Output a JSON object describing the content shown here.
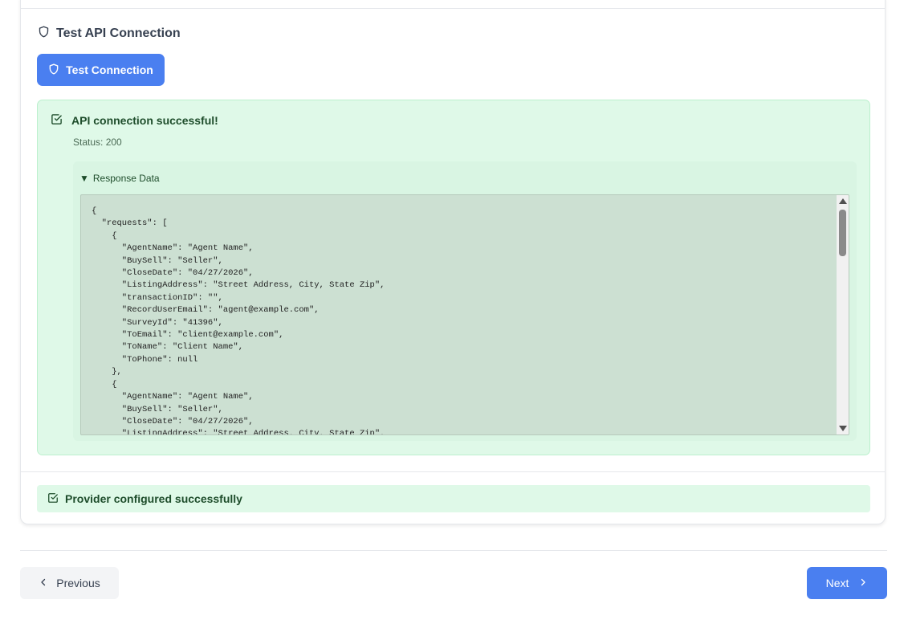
{
  "test_section": {
    "title": "Test API Connection",
    "title_icon": "shield-icon",
    "test_button_label": "Test Connection",
    "test_button_icon": "shield-icon"
  },
  "result": {
    "icon": "check-square-icon",
    "message": "API connection successful!",
    "status": "Status: 200",
    "details_summary": "Response Data",
    "details_marker": "▼",
    "response_json": "{\n  \"requests\": [\n    {\n      \"AgentName\": \"Agent Name\",\n      \"BuySell\": \"Seller\",\n      \"CloseDate\": \"04/27/2026\",\n      \"ListingAddress\": \"Street Address, City, State Zip\",\n      \"transactionID\": \"\",\n      \"RecordUserEmail\": \"agent@example.com\",\n      \"SurveyId\": \"41396\",\n      \"ToEmail\": \"client@example.com\",\n      \"ToName\": \"Client Name\",\n      \"ToPhone\": null\n    },\n    {\n      \"AgentName\": \"Agent Name\",\n      \"BuySell\": \"Seller\",\n      \"CloseDate\": \"04/27/2026\",\n      \"ListingAddress\": \"Street Address, City, State Zip\","
  },
  "provider": {
    "icon": "check-square-icon",
    "message": "Provider configured successfully"
  },
  "nav": {
    "previous_label": "Previous",
    "next_label": "Next"
  },
  "colors": {
    "primary": "#4a7ff0",
    "success_bg": "#dff9e8",
    "success_text": "#1e4d2b"
  }
}
